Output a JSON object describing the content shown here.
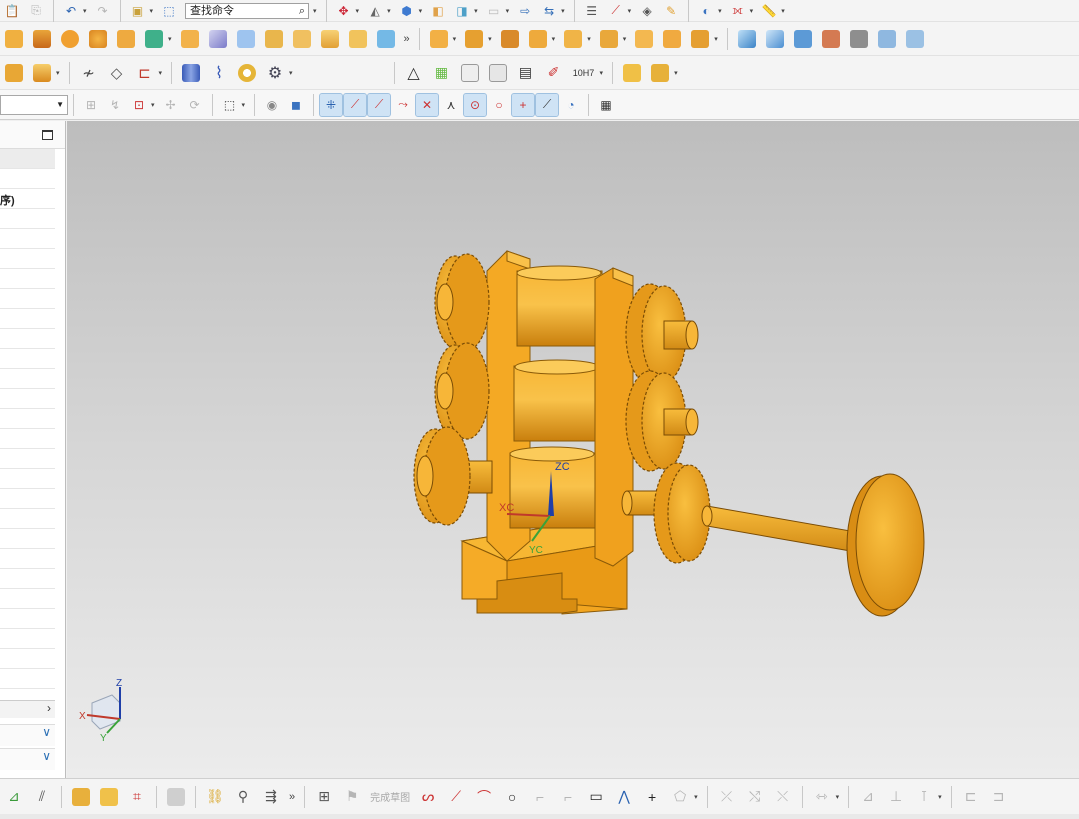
{
  "toolbar": {
    "search_placeholder": "查找命令",
    "command_filter": ""
  },
  "navigator": {
    "column_label": "序)"
  },
  "viewport": {
    "wcs_labels": {
      "zc": "ZC",
      "xc": "XC",
      "yc": "YC"
    },
    "triad_labels": {
      "z": "Z",
      "x": "X",
      "y": "Y"
    },
    "model_color": "#f5a623"
  },
  "sketch_toolbar": {
    "finish_sketch_label": "完成草图"
  },
  "inspection": {
    "fit_label": "10H7"
  }
}
